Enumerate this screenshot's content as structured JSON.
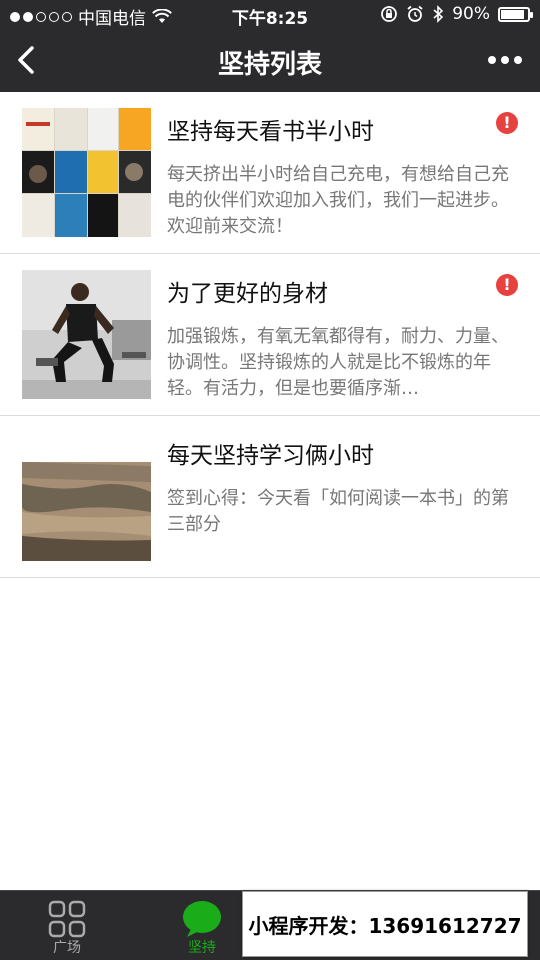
{
  "status_bar": {
    "carrier": "中国电信",
    "time": "下午8:25",
    "battery": "90%",
    "battery_level": 0.9
  },
  "nav": {
    "title": "坚持列表"
  },
  "list": {
    "items": [
      {
        "title": "坚持每天看书半小时",
        "description": "每天挤出半小时给自己充电，有想给自己充电的伙伴们欢迎加入我们，我们一起进步。欢迎前来交流！",
        "alert": "!"
      },
      {
        "title": "为了更好的身材",
        "description": "加强锻炼，有氧无氧都得有，耐力、力量、协调性。坚持锻炼的人就是比不锻炼的年轻。有活力，但是也要循序渐…",
        "alert": "!"
      },
      {
        "title": "每天坚持学习俩小时",
        "description": "签到心得：今天看「如何阅读一本书」的第三部分",
        "alert": ""
      }
    ]
  },
  "tabbar": {
    "tabs": [
      {
        "label": "广场"
      },
      {
        "label": "坚持"
      }
    ]
  },
  "promo": {
    "text": "小程序开发：13691612727"
  },
  "colors": {
    "bar_bg": "#2b2b2e",
    "accent_green": "#1aad19",
    "alert_red": "#e64340"
  }
}
